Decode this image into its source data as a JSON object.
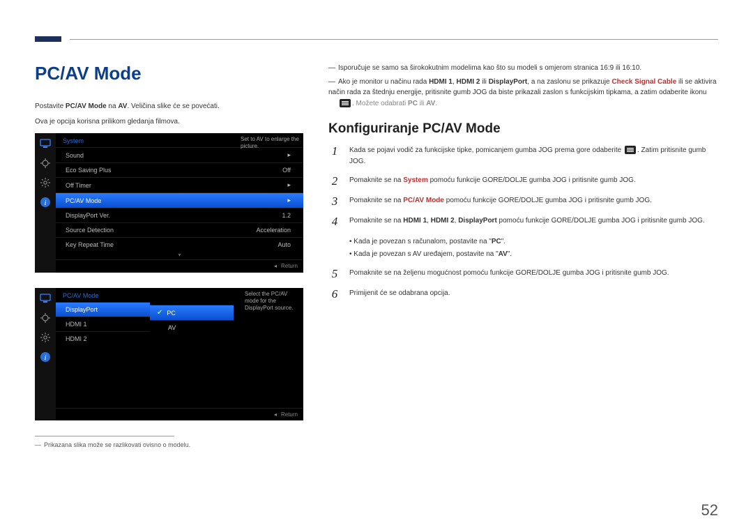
{
  "header": {
    "title": "PC/AV Mode"
  },
  "left_intro": {
    "line1_pre": "Postavite ",
    "line1_bold": "PC/AV Mode",
    "line1_mid": " na ",
    "line1_bold2": "AV",
    "line1_post": ". Veličina slike će se povećati.",
    "line2": "Ova je opcija korisna prilikom gledanja filmova."
  },
  "osd1": {
    "header": "System",
    "tip": "Set to AV to enlarge the picture.",
    "rows": [
      {
        "label": "Sound",
        "value": "▸"
      },
      {
        "label": "Eco Saving Plus",
        "value": "Off"
      },
      {
        "label": "Off Timer",
        "value": "▸"
      },
      {
        "label": "PC/AV Mode",
        "value": "▸",
        "selected": true
      },
      {
        "label": "DisplayPort Ver.",
        "value": "1.2"
      },
      {
        "label": "Source Detection",
        "value": "Acceleration"
      },
      {
        "label": "Key Repeat Time",
        "value": "Auto"
      }
    ],
    "return": "Return"
  },
  "osd2": {
    "header": "PC/AV Mode",
    "tip": "Select the PC/AV mode for the DisplayPort source.",
    "left_rows": [
      {
        "label": "DisplayPort",
        "selected": true
      },
      {
        "label": "HDMI 1"
      },
      {
        "label": "HDMI 2"
      }
    ],
    "right_opts": [
      {
        "label": "PC",
        "selected": true,
        "checked": true
      },
      {
        "label": "AV"
      }
    ],
    "return": "Return"
  },
  "left_footnote": "Prikazana slika može se razlikovati ovisno o modelu.",
  "right_notes": {
    "n1": "Isporučuje se samo sa širokokutnim modelima kao što su modeli s omjerom stranica 16:9 ili 16:10.",
    "n2_pre": "Ako je monitor u načinu rada ",
    "n2_b1": "HDMI 1",
    "n2_sep1": ", ",
    "n2_b2": "HDMI 2",
    "n2_sep2": " ili ",
    "n2_b3": "DisplayPort",
    "n2_mid": ", a na zaslonu se prikazuje ",
    "n2_red": "Check Signal Cable",
    "n2_post": " ili se aktivira način rada za štednju energije, pritisnite gumb JOG da biste prikazali zaslon s funkcijskim tipkama, a zatim odaberite ikonu",
    "n2_tail_pre": ". Možete odabrati ",
    "n2_tail_b1": "PC",
    "n2_tail_mid": " ili ",
    "n2_tail_b2": "AV",
    "n2_tail_post": "."
  },
  "section2_title": "Konfiguriranje PC/AV Mode",
  "steps": {
    "s1_pre": "Kada se pojavi vodič za funkcijske tipke, pomicanjem gumba JOG prema gore odaberite ",
    "s1_post": ". Zatim pritisnite gumb JOG.",
    "s2_pre": "Pomaknite se na ",
    "s2_red": "System",
    "s2_post": " pomoću funkcije GORE/DOLJE gumba JOG i pritisnite gumb JOG.",
    "s3_pre": "Pomaknite se na ",
    "s3_red": "PC/AV Mode",
    "s3_post": " pomoću funkcije GORE/DOLJE gumba JOG i pritisnite gumb JOG.",
    "s4_pre": "Pomaknite se na ",
    "s4_b1": "HDMI 1",
    "s4_sep1": ", ",
    "s4_b2": "HDMI 2",
    "s4_sep2": ", ",
    "s4_b3": "DisplayPort",
    "s4_post": " pomoću funkcije GORE/DOLJE gumba JOG i pritisnite gumb JOG.",
    "b1_pre": "Kada je povezan s računalom, postavite na \"",
    "b1_b": "PC",
    "b1_post": "\".",
    "b2_pre": "Kada je povezan s AV uređajem, postavite na \"",
    "b2_b": "AV",
    "b2_post": "\".",
    "s5": "Pomaknite se na željenu mogućnost pomoću funkcije GORE/DOLJE gumba JOG i pritisnite gumb JOG.",
    "s6": "Primijenit će se odabrana opcija."
  },
  "step_numbers": {
    "n1": "1",
    "n2": "2",
    "n3": "3",
    "n4": "4",
    "n5": "5",
    "n6": "6"
  },
  "page_number": "52"
}
